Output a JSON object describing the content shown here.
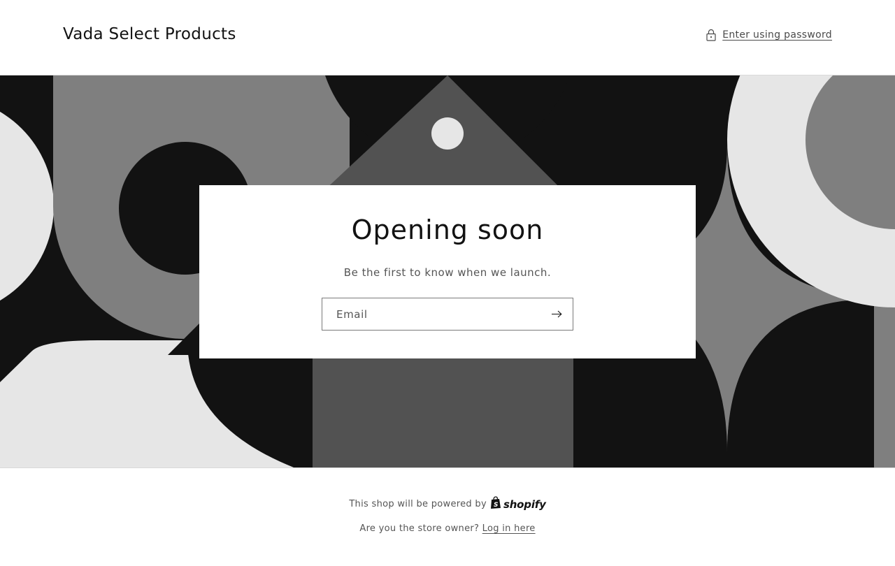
{
  "header": {
    "shop_name": "Vada Select Products",
    "password_link": "Enter using password",
    "lock_icon": "lock-icon"
  },
  "main": {
    "title": "Opening soon",
    "subtitle": "Be the first to know when we launch.",
    "email_placeholder": "Email",
    "submit_icon": "arrow-right-icon"
  },
  "footer": {
    "powered_text": "This shop will be powered by",
    "brand": "shopify",
    "brand_icon": "shopify-bag-icon",
    "owner_question": "Are you the store owner?",
    "login_link": "Log in here"
  },
  "colors": {
    "dark": "#121212",
    "mid": "#7f7f7f",
    "light": "#e6e6e6",
    "medium_dark": "#525252"
  }
}
